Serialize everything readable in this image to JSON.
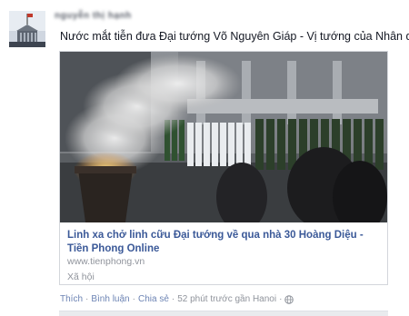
{
  "post": {
    "author_name": "nguyễn thị hạnh",
    "status_text": "Nước mắt tiễn đưa Đại tướng Võ Nguyên Giáp - Vị tướng của Nhân dân"
  },
  "link": {
    "title": "Linh xa chở linh cữu Đại tướng về qua nhà 30 Hoàng Diệu - Tiền Phong Online",
    "domain": "www.tienphong.vn",
    "category": "Xã hội"
  },
  "actions": {
    "like": "Thích",
    "comment": "Bình luận",
    "share": "Chia sẻ",
    "timestamp": "52 phút trước gần Hanoi",
    "separator": "·"
  },
  "colors": {
    "link_blue": "#3b5998",
    "action_blue": "#6d84b4",
    "meta_gray": "#90949c",
    "border": "#d3d6db"
  },
  "icons": {
    "privacy": "globe-icon"
  }
}
